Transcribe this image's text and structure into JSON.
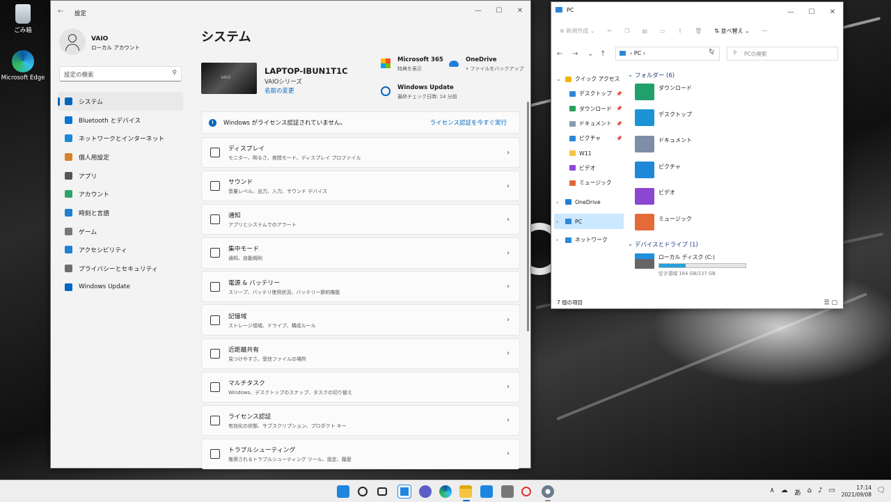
{
  "desktop": {
    "recycle_bin": "ごみ箱",
    "edge": "Microsoft Edge"
  },
  "settings": {
    "title": "設定",
    "user": {
      "name": "VAIO",
      "account": "ローカル アカウント"
    },
    "search_placeholder": "設定の検索",
    "nav": [
      {
        "label": "システム",
        "icon": "monitor-icon",
        "color": "#0067c0"
      },
      {
        "label": "Bluetooth とデバイス",
        "icon": "bluetooth-icon",
        "color": "#0a74d4"
      },
      {
        "label": "ネットワークとインターネット",
        "icon": "wifi-icon",
        "color": "#1b8ad8"
      },
      {
        "label": "個人用設定",
        "icon": "brush-icon",
        "color": "#d9822b"
      },
      {
        "label": "アプリ",
        "icon": "apps-icon",
        "color": "#555555"
      },
      {
        "label": "アカウント",
        "icon": "person-icon",
        "color": "#2ea36a"
      },
      {
        "label": "時刻と言語",
        "icon": "globe-clock-icon",
        "color": "#1f7fd1"
      },
      {
        "label": "ゲーム",
        "icon": "gamepad-icon",
        "color": "#777777"
      },
      {
        "label": "アクセシビリティ",
        "icon": "accessibility-icon",
        "color": "#1f7fd1"
      },
      {
        "label": "プライバシーとセキュリティ",
        "icon": "shield-icon",
        "color": "#6d6d6d"
      },
      {
        "label": "Windows Update",
        "icon": "update-icon",
        "color": "#0067c0"
      }
    ],
    "page_title": "システム",
    "device": {
      "image_label": "VAIO",
      "name": "LAPTOP-IBUN1T1C",
      "model": "VAIOシリーズ",
      "rename": "名前の変更"
    },
    "services": [
      {
        "title": "Microsoft 365",
        "sub": "特典を表示",
        "icon": "microsoft-365-icon"
      },
      {
        "title": "OneDrive",
        "sub": "• ファイルをバックアップ",
        "icon": "onedrive-icon"
      },
      {
        "title": "Windows Update",
        "sub": "最終チェック日時: 14 分前",
        "icon": "windows-update-icon"
      }
    ],
    "banner": {
      "message": "Windows がライセンス認証されていません。",
      "action": "ライセンス認証を今すぐ実行"
    },
    "cards": [
      {
        "title": "ディスプレイ",
        "sub": "モニター、明るさ、夜間モード、ディスプレイ プロファイル",
        "icon": "display-icon"
      },
      {
        "title": "サウンド",
        "sub": "音量レベル、出力、入力、サウンド デバイス",
        "icon": "speaker-icon"
      },
      {
        "title": "通知",
        "sub": "アプリとシステムでのアラート",
        "icon": "bell-icon"
      },
      {
        "title": "集中モード",
        "sub": "通知、自動規則",
        "icon": "moon-icon"
      },
      {
        "title": "電源 & バッテリー",
        "sub": "スリープ、バッテリ使用状況、バッテリー節約機能",
        "icon": "power-icon"
      },
      {
        "title": "記憶域",
        "sub": "ストレージ領域、ドライブ、構成ルール",
        "icon": "storage-icon"
      },
      {
        "title": "近距離共有",
        "sub": "見つけやすさ、受信ファイルの場所",
        "icon": "share-icon"
      },
      {
        "title": "マルチタスク",
        "sub": "Windows、デスクトップのスナップ、タスクの切り替え",
        "icon": "multitask-icon"
      },
      {
        "title": "ライセンス認証",
        "sub": "有効化の状態、サブスクリプション、プロダクト キー",
        "icon": "check-circle-icon"
      },
      {
        "title": "トラブルシューティング",
        "sub": "推奨されるトラブルシューティング ツール、設定、履歴",
        "icon": "wrench-icon"
      }
    ]
  },
  "explorer": {
    "title": "PC",
    "toolbar": {
      "new": "新規作成",
      "sort": "並べ替え",
      "more": "···"
    },
    "address": "PC",
    "search_placeholder": "PCの検索",
    "tree": [
      {
        "label": "クイック アクセス",
        "color": "#f5b400",
        "pin": false,
        "indent": 0,
        "arrow": "v"
      },
      {
        "label": "デスクトップ",
        "color": "#2b88d8",
        "pin": true,
        "indent": 1,
        "arrow": ""
      },
      {
        "label": "ダウンロード",
        "color": "#2aa05a",
        "pin": true,
        "indent": 1,
        "arrow": ""
      },
      {
        "label": "ドキュメント",
        "color": "#8a9bb0",
        "pin": true,
        "indent": 1,
        "arrow": ""
      },
      {
        "label": "ピクチャ",
        "color": "#2b88d8",
        "pin": true,
        "indent": 1,
        "arrow": ""
      },
      {
        "label": "W11",
        "color": "#f5c542",
        "pin": false,
        "indent": 1,
        "arrow": ""
      },
      {
        "label": "ビデオ",
        "color": "#8a4bd8",
        "pin": false,
        "indent": 1,
        "arrow": ""
      },
      {
        "label": "ミュージック",
        "color": "#e06a3c",
        "pin": false,
        "indent": 1,
        "arrow": ""
      },
      {
        "label": "OneDrive",
        "color": "#1e7fd8",
        "pin": false,
        "indent": 0,
        "arrow": ">"
      },
      {
        "label": "PC",
        "color": "#2b88d8",
        "pin": false,
        "indent": 0,
        "arrow": ">",
        "selected": true
      },
      {
        "label": "ネットワーク",
        "color": "#2b88d8",
        "pin": false,
        "indent": 0,
        "arrow": ">"
      }
    ],
    "folders_header": "フォルダー (6)",
    "folders": [
      {
        "name": "ダウンロード",
        "color": "#22a06b"
      },
      {
        "name": "デスクトップ",
        "color": "#1c93d6"
      },
      {
        "name": "ドキュメント",
        "color": "#7d8ea6"
      },
      {
        "name": "ピクチャ",
        "color": "#1f88d8"
      },
      {
        "name": "ビデオ",
        "color": "#8b47d1"
      },
      {
        "name": "ミュージック",
        "color": "#e56a3a"
      }
    ],
    "drives_header": "デバイスとドライブ (1)",
    "drive": {
      "name": "ローカル ディスク (C:)",
      "free": "空き領域 164 GB/237 GB",
      "used_fraction": 0.31
    },
    "status": "7 個の項目"
  },
  "taskbar": {
    "time": "17:14",
    "date": "2021/09/08",
    "ime": "あ"
  }
}
